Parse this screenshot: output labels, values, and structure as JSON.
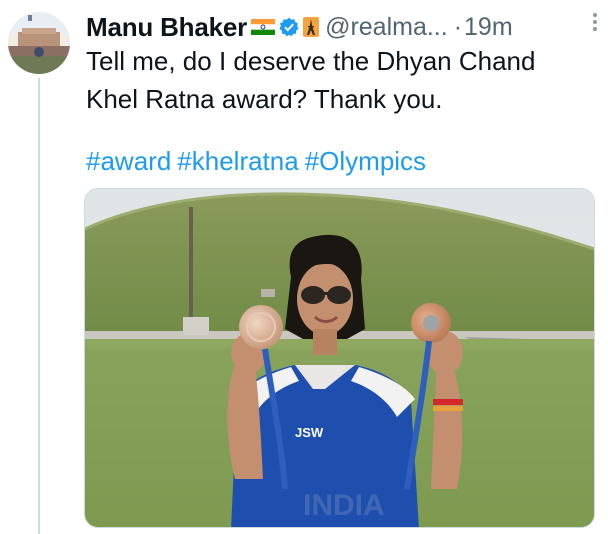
{
  "tweet": {
    "display_name": "Manu Bhaker",
    "handle": "@realma...",
    "separator": "·",
    "time": "19m",
    "text": "Tell me, do I deserve the Dhyan Chand Khel Ratna award? Thank you.",
    "hashtags": [
      "#award",
      "#khelratna",
      "#Olympics"
    ]
  },
  "media": {
    "jersey_logo": "JSW",
    "jersey_word": "INDIA"
  },
  "colors": {
    "hashtag": "#1d9bf0",
    "verified": "#1d9bf0",
    "muted": "#536471"
  },
  "icons": [
    "india-flag-icon",
    "verified-badge-icon",
    "eiffel-tower-icon",
    "more-options-icon"
  ]
}
